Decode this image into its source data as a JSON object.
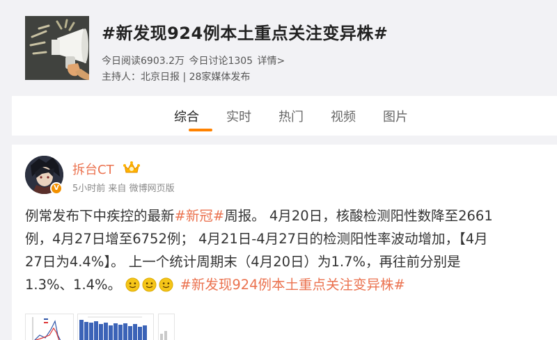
{
  "topic": {
    "title": "#新发现924例本土重点关注变异株#",
    "reads": "今日阅读6903.2万",
    "discussions": "今日讨论1305",
    "details_link": "详情>",
    "host": "主持人：北京日报 | 28家媒体发布",
    "cover_icon": "megaphone-icon"
  },
  "tabs": [
    {
      "label": "综合",
      "active": true
    },
    {
      "label": "实时",
      "active": false
    },
    {
      "label": "热门",
      "active": false
    },
    {
      "label": "视频",
      "active": false
    },
    {
      "label": "图片",
      "active": false
    }
  ],
  "colors": {
    "accent": "#ff8200",
    "link": "#eb7350",
    "badge": "#f29100"
  },
  "post": {
    "author": "拆台CT",
    "verified_badge": "V",
    "time": "5小时前",
    "source_prefix": "来自",
    "source": "微博网页版",
    "text": {
      "l1_a": "例常发布下中疾控的最新",
      "l1_tag": "#新冠#",
      "l1_b": "周报。 4月20日，核酸检测阳性数降至2661",
      "l2": "例，4月27日增至6752例； 4月21日-4月27日的检测阳性率波动增加，【4月",
      "l3": "27日为4.4%】。 上一个统计周期末（4月20日）为1.7%，再往前分别是",
      "l4_a": "1.3%、1.4%。",
      "l4_tag": "#新发现924例本土重点关注变异株#"
    },
    "emoji_names": [
      "doge-smile-icon",
      "doge-smile-icon",
      "doge-smile-icon"
    ]
  }
}
